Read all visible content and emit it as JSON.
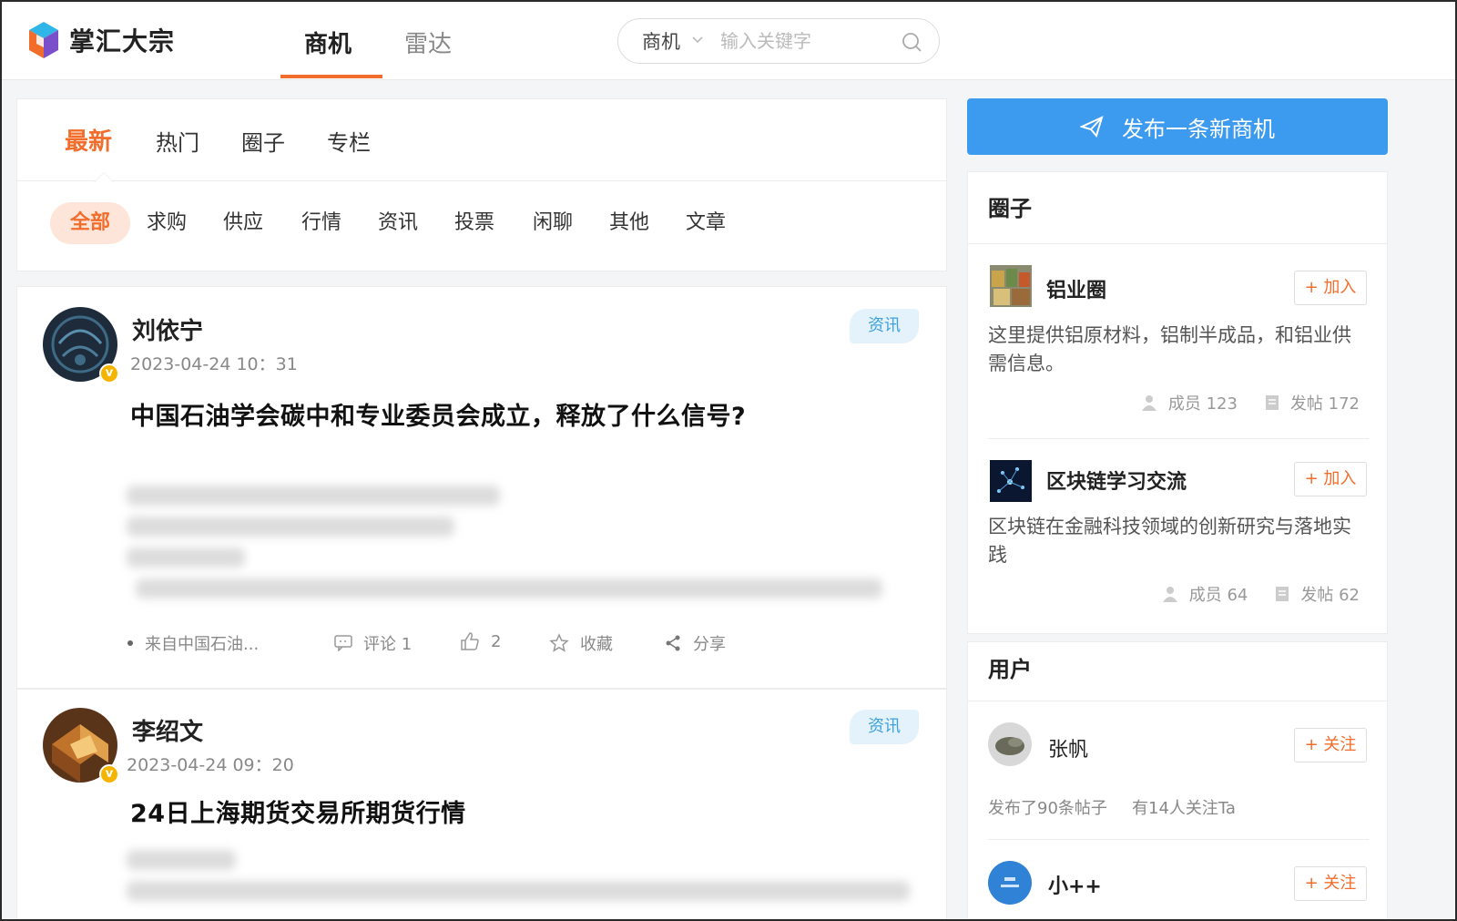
{
  "brand": {
    "name": "掌汇大宗"
  },
  "nav": {
    "tabs": [
      {
        "label": "商机"
      },
      {
        "label": "雷达"
      }
    ]
  },
  "search": {
    "category": "商机",
    "placeholder": "输入关键字"
  },
  "main_tabs": [
    {
      "label": "最新"
    },
    {
      "label": "热门"
    },
    {
      "label": "圈子"
    },
    {
      "label": "专栏"
    }
  ],
  "sub_categories": [
    {
      "label": "全部"
    },
    {
      "label": "求购"
    },
    {
      "label": "供应"
    },
    {
      "label": "行情"
    },
    {
      "label": "资讯"
    },
    {
      "label": "投票"
    },
    {
      "label": "闲聊"
    },
    {
      "label": "其他"
    },
    {
      "label": "文章"
    }
  ],
  "posts": [
    {
      "author": "刘依宁",
      "time": "2023-04-24 10：31",
      "badge": "资讯",
      "title": "中国石油学会碳中和专业委员会成立，释放了什么信号?",
      "source": "来自中国石油...",
      "comments": "评论 1",
      "likes": "2",
      "favorite": "收藏",
      "share": "分享"
    },
    {
      "author": "李绍文",
      "time": "2023-04-24 09：20",
      "badge": "资讯",
      "title": "24日上海期货交易所期货行情"
    }
  ],
  "sidebar": {
    "publish_label": "发布一条新商机",
    "circles_title": "圈子",
    "circles": [
      {
        "name": "铝业圈",
        "join_label": "+ 加入",
        "desc": "这里提供铝原材料，铝制半成品，和铝业供需信息。",
        "members": "成员  123",
        "posts": "发帖  172"
      },
      {
        "name": "区块链学习交流",
        "join_label": "+ 加入",
        "desc": "区块链在金融科技领域的创新研究与落地实践",
        "members": "成员  64",
        "posts": "发帖  62"
      }
    ],
    "users_title": "用户",
    "users": [
      {
        "name": "张帆",
        "follow_label": "+ 关注",
        "posts_count": "发布了90条帖子",
        "followers": "有14人关注Ta"
      },
      {
        "name": "小++",
        "follow_label": "+ 关注"
      }
    ]
  },
  "colors": {
    "accent": "#f26d2b",
    "primary_blue": "#3c9bee",
    "badge_blue": "#3ea0dc"
  }
}
